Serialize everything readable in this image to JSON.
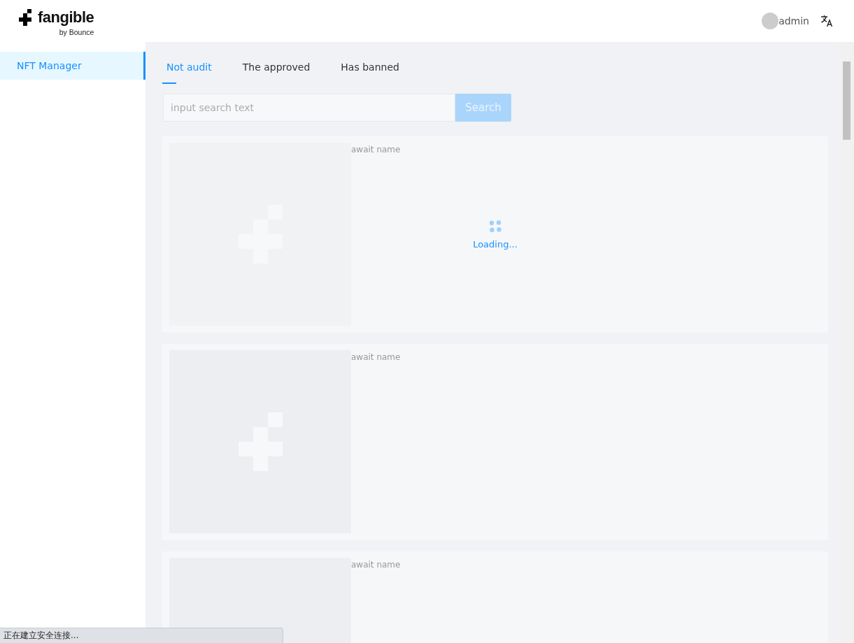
{
  "logo": {
    "name": "fangible",
    "byline": "by Bounce"
  },
  "header": {
    "user": "admin"
  },
  "sidebar": {
    "items": [
      {
        "label": "NFT Manager",
        "selected": true
      }
    ]
  },
  "tabs": [
    {
      "label": "Not audit",
      "selected": true
    },
    {
      "label": "The approved",
      "selected": false
    },
    {
      "label": "Has banned",
      "selected": false
    }
  ],
  "search": {
    "placeholder": "input search text",
    "button": "Search"
  },
  "cards": [
    {
      "name": "await name",
      "loading": true,
      "loading_text": "Loading..."
    },
    {
      "name": "await name",
      "loading": false
    },
    {
      "name": "await name",
      "loading": false
    }
  ],
  "status_bubble": "正在建立安全连接..."
}
